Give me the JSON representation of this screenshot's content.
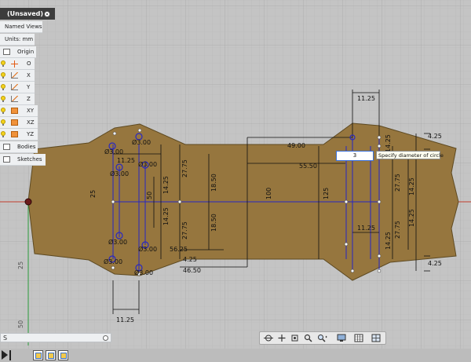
{
  "browser": {
    "title": "(Unsaved)",
    "named_views": "Named Views",
    "units": "Units: mm",
    "origin": "Origin",
    "items": [
      "O",
      "X",
      "Y",
      "Z",
      "XY",
      "XZ",
      "YZ"
    ],
    "bodies": "Bodies",
    "sketches": "Sketches"
  },
  "bottom_bar": {
    "label": "S"
  },
  "dimension_input": {
    "value": "3",
    "tooltip": "Specify diameter of circle"
  },
  "dims": {
    "hole_dia_1": "Ø3.00",
    "hole_dia_2": "Ø3.00",
    "hole_dia_3": "Ø3.00",
    "hole_dia_4": "Ø3.00",
    "hole_dia_5": "Ø3.00",
    "hole_dia_6": "Ø3.00",
    "hole_dia_7": "Ø3.00",
    "hole_dia_8": "Ø3.00",
    "w_11_25_top_left": "11.25",
    "w_11_25_bottom_left": "11.25",
    "w_11_25_top_right": "11.25",
    "w_11_25_mid_right": "11.25",
    "d_25_left": "25",
    "d_50": "50",
    "d_100": "100",
    "d_125": "125",
    "d_14_25_a": "14.25",
    "d_14_25_b": "14.25",
    "d_14_25_c": "14.25",
    "d_14_25_d": "14.25",
    "d_14_25_e": "14.25",
    "d_14_25_f": "14.25",
    "d_27_75_a": "27.75",
    "d_27_75_b": "27.75",
    "d_27_75_c": "27.75",
    "d_27_75_d": "27.75",
    "d_18_50_a": "18.50",
    "d_18_50_b": "18.50",
    "d_49_00": "49.00",
    "d_55_50": "55.50",
    "d_56_25": "56.25",
    "d_46_50": "46.50",
    "d_4_25_a": "4.25",
    "d_4_25_b": "4.25",
    "d_4_25_c": "4.25"
  },
  "grid_labels": {
    "ruler_25": "25",
    "ruler_50": "50"
  },
  "navbar_icons": [
    "orbit-icon",
    "pan-icon",
    "look-at-icon",
    "zoom-icon",
    "zoom-window-icon",
    "display-settings-icon",
    "grid-settings-icon",
    "viewports-icon"
  ],
  "colors": {
    "sketch_fill": "#96763e",
    "sketch_line": "#2727c4",
    "dim_line": "#111111",
    "canvas_bg": "#c4c4c4",
    "grid": "#b7b7b7",
    "x_axis": "#c23b2b",
    "y_axis": "#2a9a3a"
  }
}
